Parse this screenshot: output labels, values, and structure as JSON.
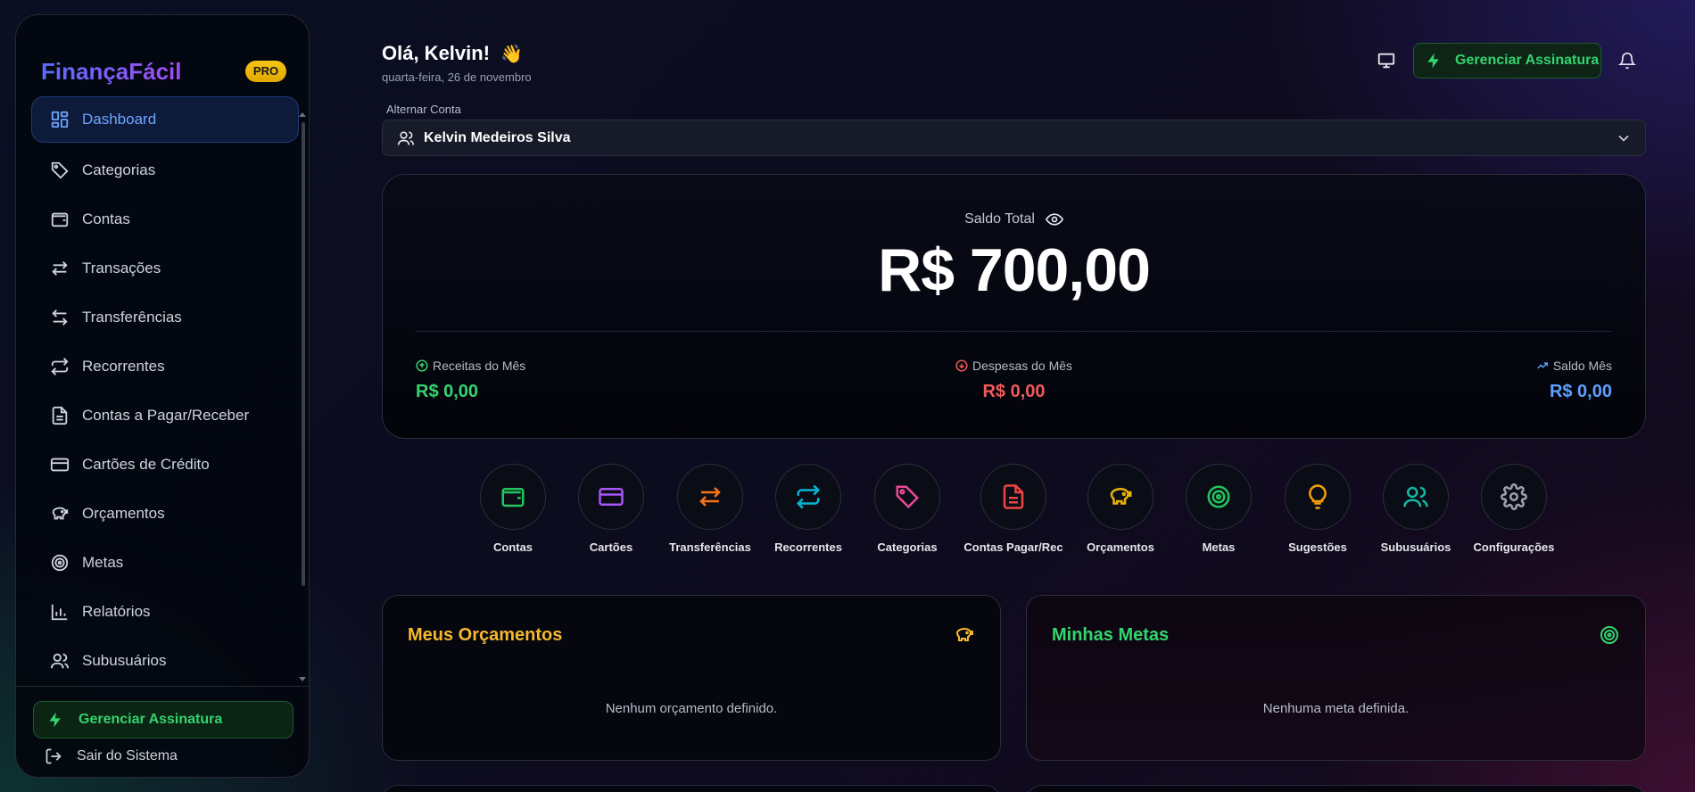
{
  "sidebar": {
    "brand": "FinançaFácil",
    "badge": "PRO",
    "items": [
      {
        "label": "Dashboard",
        "icon": "dashboard-grid-icon",
        "active": true
      },
      {
        "label": "Categorias",
        "icon": "tag-icon"
      },
      {
        "label": "Contas",
        "icon": "wallet-icon"
      },
      {
        "label": "Transações",
        "icon": "arrows-swap-icon"
      },
      {
        "label": "Transferências",
        "icon": "transfer-icon"
      },
      {
        "label": "Recorrentes",
        "icon": "repeat-icon"
      },
      {
        "label": "Contas a Pagar/Receber",
        "icon": "document-icon"
      },
      {
        "label": "Cartões de Crédito",
        "icon": "credit-card-icon"
      },
      {
        "label": "Orçamentos",
        "icon": "piggy-bank-icon"
      },
      {
        "label": "Metas",
        "icon": "target-icon"
      },
      {
        "label": "Relatórios",
        "icon": "bar-chart-icon"
      },
      {
        "label": "Subusuários",
        "icon": "users-icon"
      }
    ],
    "manage_subscription": "Gerenciar Assinatura",
    "logout": "Sair do Sistema"
  },
  "header": {
    "greeting": "Olá, Kelvin!",
    "wave": "👋",
    "date": "quarta-feira, 26 de novembro",
    "manage_subscription": "Gerenciar Assinatura"
  },
  "account": {
    "label": "Alternar Conta",
    "selected": "Kelvin Medeiros Silva"
  },
  "balance": {
    "label": "Saldo Total",
    "value": "R$ 700,00",
    "income_label": "Receitas do Mês",
    "income_value": "R$ 0,00",
    "expense_label": "Despesas do Mês",
    "expense_value": "R$ 0,00",
    "monthly_label": "Saldo Mês",
    "monthly_value": "R$ 0,00"
  },
  "quick_actions": [
    {
      "label": "Contas",
      "icon": "wallet-icon",
      "color": "#22c55e"
    },
    {
      "label": "Cartões",
      "icon": "credit-card-icon",
      "color": "#a855f7"
    },
    {
      "label": "Transferências",
      "icon": "arrows-swap-icon",
      "color": "#f97316"
    },
    {
      "label": "Recorrentes",
      "icon": "repeat-icon",
      "color": "#06b6d4"
    },
    {
      "label": "Categorias",
      "icon": "tag-icon",
      "color": "#ec4899"
    },
    {
      "label": "Contas Pagar/Rec",
      "icon": "document-icon",
      "color": "#ef4444"
    },
    {
      "label": "Orçamentos",
      "icon": "piggy-bank-icon",
      "color": "#eab308"
    },
    {
      "label": "Metas",
      "icon": "target-icon",
      "color": "#22c55e"
    },
    {
      "label": "Sugestões",
      "icon": "lightbulb-icon",
      "color": "#f59e0b"
    },
    {
      "label": "Subusuários",
      "icon": "users-icon",
      "color": "#14b8a6"
    },
    {
      "label": "Configurações",
      "icon": "gear-icon",
      "color": "#9ca3af"
    }
  ],
  "budgets": {
    "title": "Meus Orçamentos",
    "empty": "Nenhum orçamento definido."
  },
  "goals": {
    "title": "Minhas Metas",
    "empty": "Nenhuma meta definida."
  },
  "colors": {
    "accent_blue": "#6ea5ff",
    "income_green": "#34d46e",
    "expense_red": "#f05a5a",
    "monthly_blue": "#5ea0ff",
    "budget_title": "#f5b82e",
    "goal_title": "#34d46e"
  }
}
